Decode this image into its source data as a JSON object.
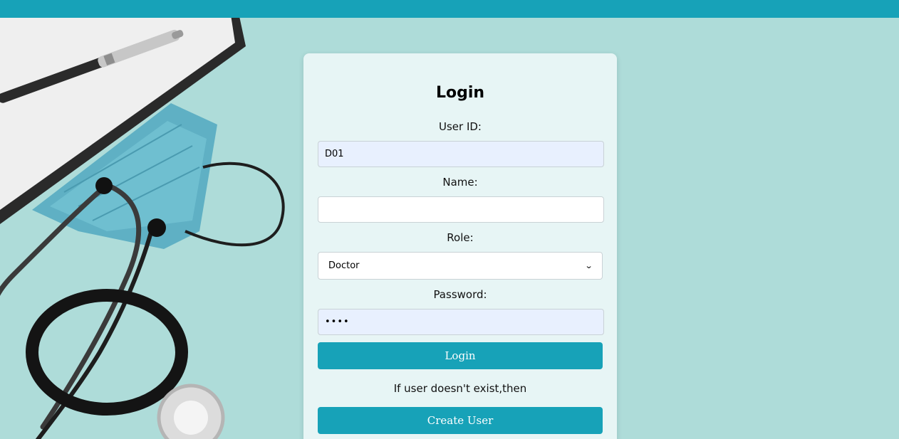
{
  "login_form": {
    "title": "Login",
    "user_id_label": "User ID:",
    "user_id_value": "D01",
    "name_label": "Name:",
    "name_value": "",
    "role_label": "Role:",
    "role_selected": "Doctor",
    "password_label": "Password:",
    "password_value": "••••",
    "login_button": "Login",
    "hint_text": "If user doesn't exist,then",
    "create_user_button": "Create User"
  },
  "colors": {
    "top_bar": "#17a2b8",
    "page_background": "#aedcd9",
    "button": "#17a2b8"
  }
}
